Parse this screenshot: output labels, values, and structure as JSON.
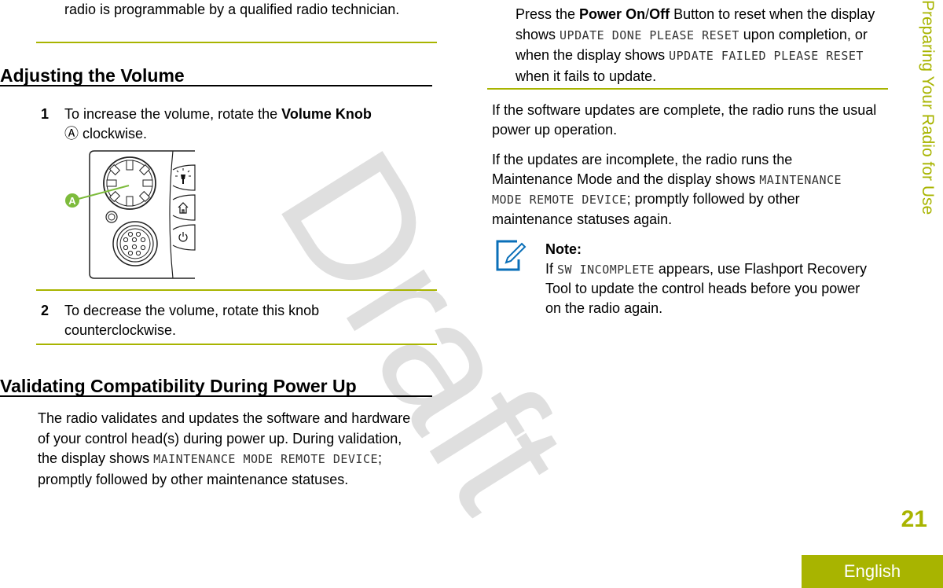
{
  "left_column": {
    "intro_tail": "radio is programmable by a qualified radio technician.",
    "section1": {
      "title": "Adjusting the Volume",
      "step1": {
        "number": "1",
        "text_before": "To increase the volume, rotate the ",
        "bold": "Volume Knob",
        "callout": "Ⓐ",
        "text_after": " clockwise."
      },
      "figure": {
        "callout_label": "A",
        "icons": [
          "knob-icon",
          "light-icon",
          "home-icon",
          "power-icon",
          "connector-icon"
        ]
      },
      "step2": {
        "number": "2",
        "text": "To decrease the volume, rotate this knob counterclockwise."
      }
    },
    "section2": {
      "title": "Validating Compatibility During Power Up",
      "para_before": "The radio validates and updates the software and hardware of your control head(s) during power up. During validation, the display shows ",
      "para_mono": "MAINTENANCE MODE REMOTE DEVICE",
      "para_after": "; promptly followed by other maintenance statuses."
    }
  },
  "right_column": {
    "step_text": {
      "t1": "Press the ",
      "b1": "Power On",
      "t2": "/",
      "b2": "Off",
      "t3": " Button to reset when the display shows ",
      "m1": "UPDATE DONE PLEASE RESET",
      "t4": " upon completion, or when the display shows ",
      "m2": "UPDATE FAILED PLEASE RESET",
      "t5": " when it fails to update."
    },
    "para1": "If the software updates are complete, the radio runs the usual power up operation.",
    "para2_before": "If the updates are incomplete, the radio runs the Maintenance Mode and the display shows ",
    "para2_mono": "MAINTENANCE MODE REMOTE DEVICE",
    "para2_after": "; promptly followed by other maintenance statuses again.",
    "note": {
      "label": "Note:",
      "t1": "If ",
      "mono": "SW INCOMPLETE",
      "t2": " appears, use Flashport Recovery Tool to update the control heads before you power on the radio again."
    }
  },
  "side_title": "Preparing Your Radio for Use",
  "page_number": "21",
  "language_tab": "English",
  "watermark": "Draft",
  "colors": {
    "accent": "#a8b400",
    "note_icon": "#0a6fb8"
  }
}
